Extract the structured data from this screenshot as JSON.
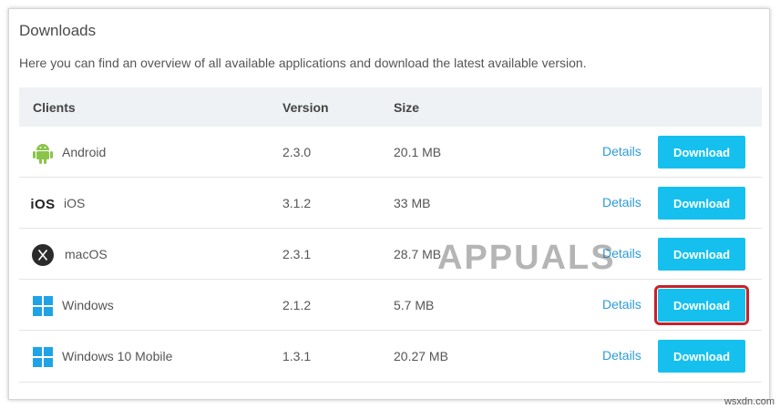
{
  "header": {
    "title": "Downloads",
    "subtitle": "Here you can find an overview of all available applications and download the latest available version."
  },
  "table": {
    "columns": [
      "Clients",
      "Version",
      "Size"
    ],
    "rows": [
      {
        "name": "Android",
        "icon": "android-icon",
        "version": "2.3.0",
        "size": "20.1 MB",
        "details": "Details",
        "download": "Download"
      },
      {
        "name": "iOS",
        "icon": "ios-logo-icon",
        "icon_text": "iOS",
        "version": "3.1.2",
        "size": "33 MB",
        "details": "Details",
        "download": "Download"
      },
      {
        "name": "macOS",
        "icon": "macos-x-icon",
        "version": "2.3.1",
        "size": "28.7 MB",
        "details": "Details",
        "download": "Download"
      },
      {
        "name": "Windows",
        "icon": "windows-icon",
        "version": "2.1.2",
        "size": "5.7 MB",
        "details": "Details",
        "download": "Download",
        "highlighted": true
      },
      {
        "name": "Windows 10 Mobile",
        "icon": "windows-icon",
        "version": "1.3.1",
        "size": "20.27 MB",
        "details": "Details",
        "download": "Download"
      }
    ]
  },
  "watermark": {
    "brand": "APPUALS",
    "site": "wsxdn.com"
  },
  "colors": {
    "accent": "#15c0ef",
    "link": "#2d9bd6",
    "highlight": "#c8202b",
    "header_bg": "#eef2f4"
  }
}
